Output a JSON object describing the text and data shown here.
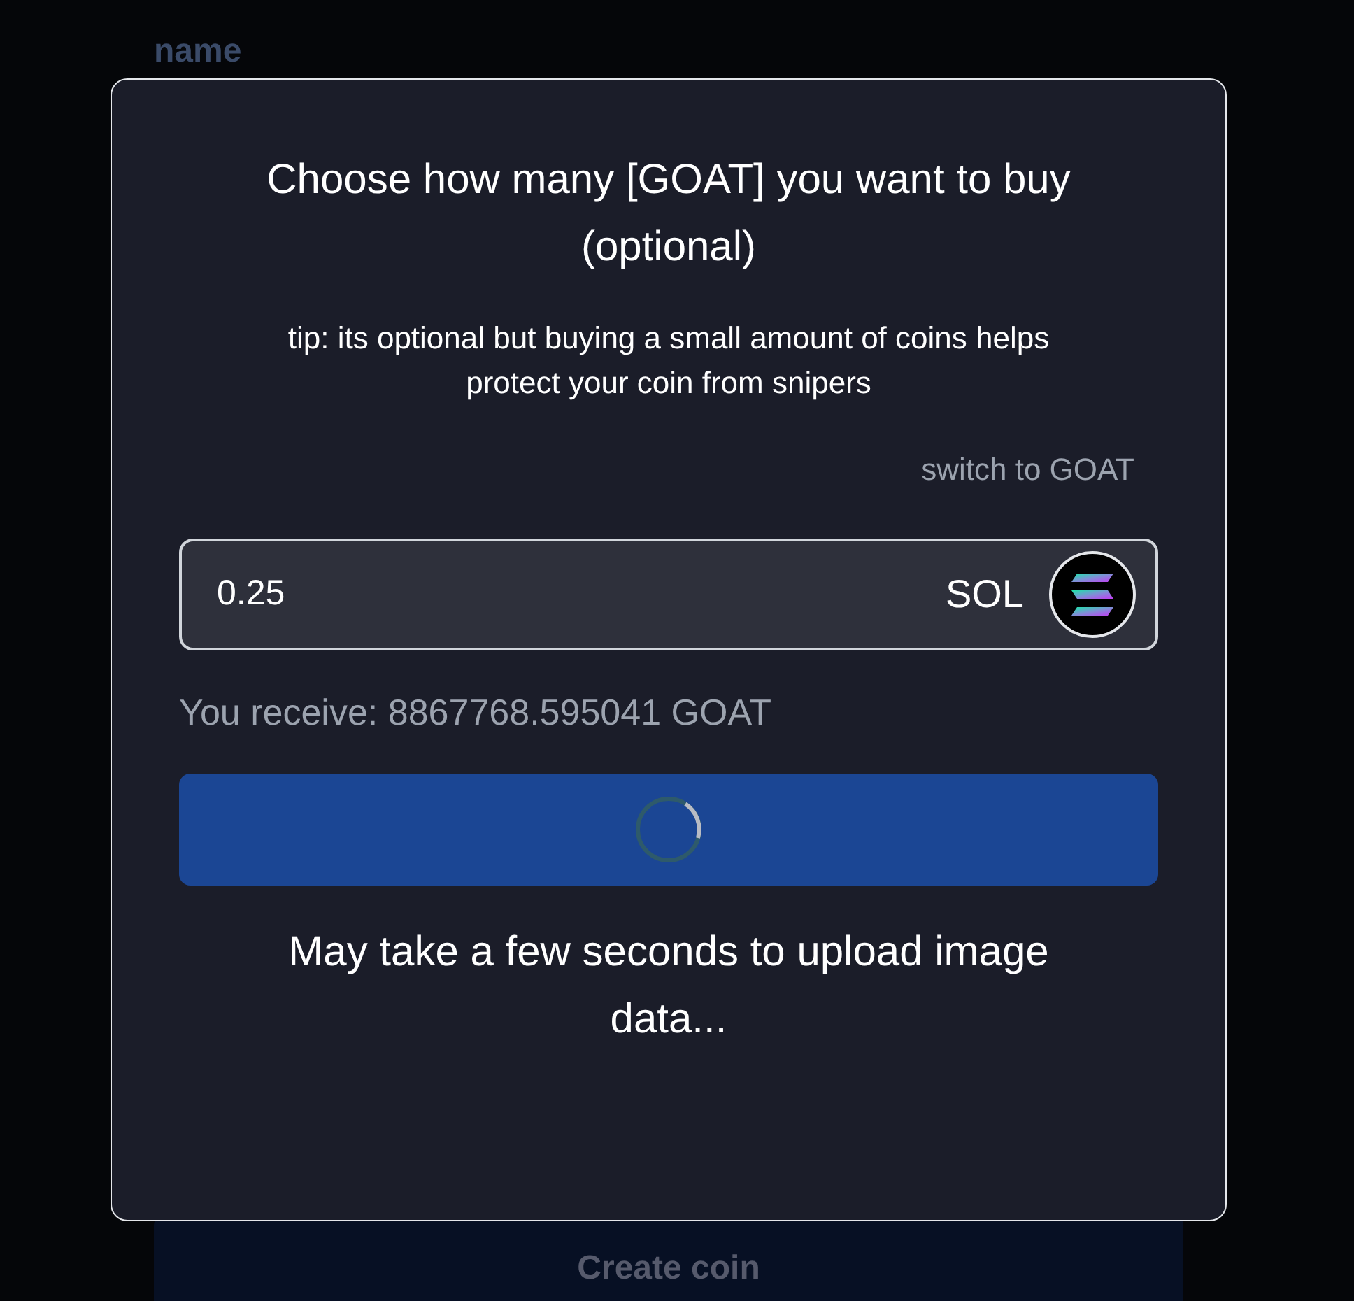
{
  "background": {
    "field_label": "name",
    "submit_button": "Create coin"
  },
  "dialog": {
    "title": "Choose how many [GOAT] you want to buy (optional)",
    "tip": "tip: its optional but buying a small amount of coins helps protect your coin from snipers",
    "switch_link": "switch to GOAT",
    "amount_field": {
      "value": "0.25",
      "currency": "SOL"
    },
    "receive_text": "You receive: 8867768.595041 GOAT",
    "submit_button": {
      "loading": true
    },
    "note": "May take a few seconds to upload image data..."
  }
}
